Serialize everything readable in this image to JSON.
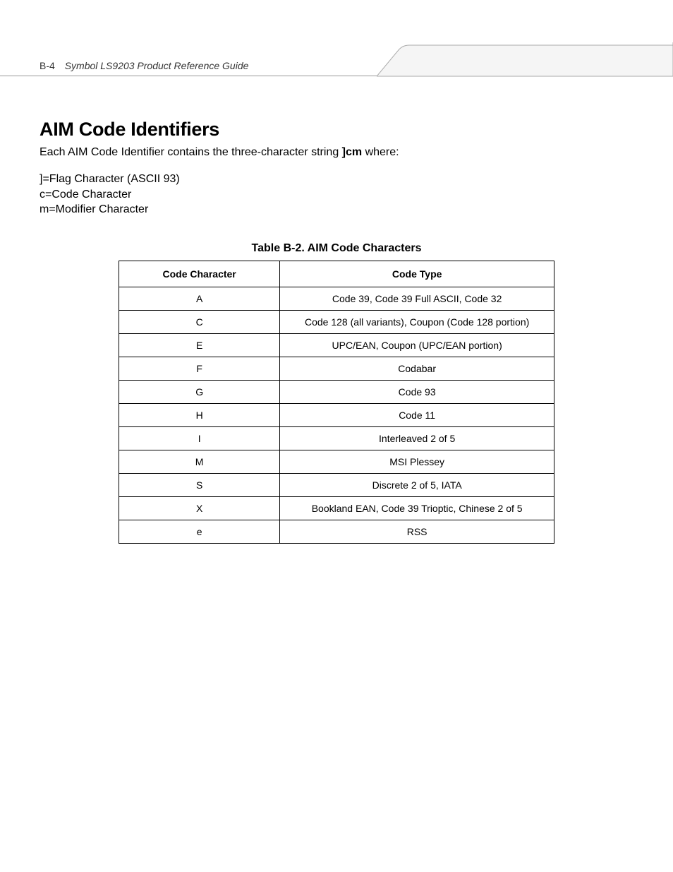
{
  "header": {
    "page_number": "B-4",
    "doc_title": "Symbol LS9203 Product Reference Guide"
  },
  "heading": "AIM Code Identifiers",
  "intro": {
    "prefix": "Each AIM Code Identifier contains the three-character string ",
    "bold": "]cm",
    "suffix": " where:"
  },
  "definitions": [
    "]=Flag Character (ASCII 93)",
    "c=Code Character",
    "m=Modifier Character"
  ],
  "table": {
    "caption": "Table B-2.  AIM Code Characters",
    "headers": [
      "Code Character",
      "Code Type"
    ],
    "rows": [
      [
        "A",
        "Code 39, Code 39 Full ASCII, Code 32"
      ],
      [
        "C",
        "Code 128 (all variants), Coupon (Code 128 portion)"
      ],
      [
        "E",
        "UPC/EAN, Coupon (UPC/EAN portion)"
      ],
      [
        "F",
        "Codabar"
      ],
      [
        "G",
        "Code 93"
      ],
      [
        "H",
        "Code 11"
      ],
      [
        "I",
        "Interleaved 2 of 5"
      ],
      [
        "M",
        "MSI Plessey"
      ],
      [
        "S",
        "Discrete 2 of 5, IATA"
      ],
      [
        "X",
        "Bookland EAN, Code 39 Trioptic, Chinese 2 of 5"
      ],
      [
        "e",
        "RSS"
      ]
    ]
  }
}
